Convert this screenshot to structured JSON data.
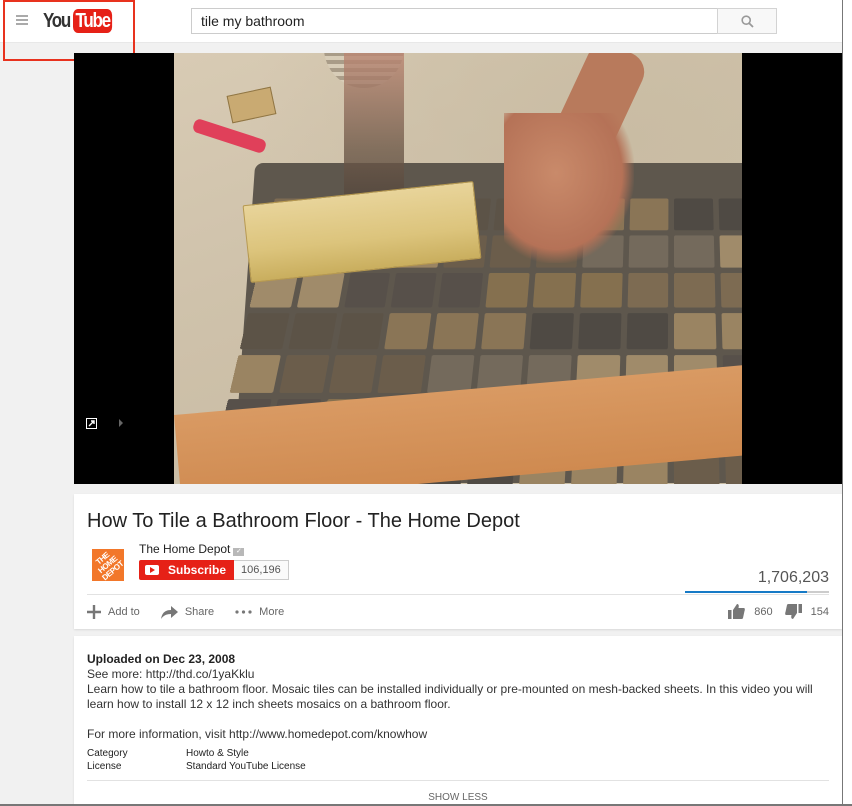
{
  "masthead": {
    "logo": {
      "you": "You",
      "tube": "Tube"
    },
    "search": {
      "value": "tile my bathroom",
      "icon": "search-icon"
    },
    "guide_icon": "hamburger-menu-icon"
  },
  "player": {
    "controls": {
      "popout_icon": "external-link-icon",
      "next_icon": "chevron-right-icon"
    }
  },
  "video": {
    "title": "How To Tile a Bathroom Floor - The Home Depot",
    "channel": {
      "name": "The Home Depot",
      "avatar_text": "THE HOME DEPOT",
      "verified_icon": "verified-check-icon",
      "subscribe_label": "Subscribe",
      "subscriber_count": "106,196"
    },
    "views": "1,706,203",
    "likes": "860",
    "dislikes": "154",
    "like_ratio": 0.848,
    "actions": [
      {
        "label": "Add to",
        "icon": "plus-icon"
      },
      {
        "label": "Share",
        "icon": "share-arrow-icon"
      },
      {
        "label": "More",
        "icon": "more-dots-icon"
      }
    ]
  },
  "description": {
    "upload_date": "Uploaded on Dec 23, 2008",
    "see_more_prefix": "See more: ",
    "see_more_link": "http://thd.co/1yaKklu",
    "body": "Learn how to tile a bathroom floor. Mosaic tiles can be installed individually or pre-mounted on mesh-backed sheets. In this video you will learn how to install 12 x 12 inch sheets mosaics on a bathroom floor.",
    "more_info_prefix": "For more information, visit ",
    "more_info_link": "http://www.homedepot.com/knowhow",
    "meta": [
      {
        "label": "Category",
        "value": "Howto & Style"
      },
      {
        "label": "License",
        "value": "Standard YouTube License"
      }
    ],
    "show_less_label": "SHOW LESS"
  },
  "colors": {
    "brand_red": "#e62117",
    "highlight_box": "#e8321e",
    "like_bar": "#167ac6",
    "home_depot_orange": "#f2772a"
  }
}
